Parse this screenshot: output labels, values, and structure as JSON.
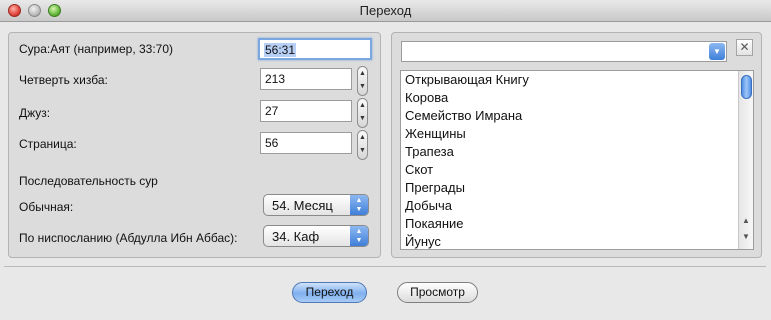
{
  "window": {
    "title": "Переход"
  },
  "left": {
    "sura_ayat_label": "Сура:Аят (например, 33:70)",
    "sura_ayat_value": "56:31",
    "hizb_label": "Четверть хизба:",
    "hizb_value": "213",
    "juz_label": "Джуз:",
    "juz_value": "27",
    "page_label": "Страница:",
    "page_value": "56",
    "order_heading": "Последовательность сур",
    "ordinary_label": "Обычная:",
    "ordinary_value": "54. Месяц",
    "revelation_label": "По ниспосланию (Абдулла Ибн Аббас):",
    "revelation_value": "34. Каф"
  },
  "right": {
    "search_value": "",
    "suras": [
      "Открывающая Книгу",
      "Корова",
      "Семейство Имрана",
      "Женщины",
      "Трапеза",
      "Скот",
      "Преграды",
      "Добыча",
      "Покаяние",
      "Йунус"
    ]
  },
  "buttons": {
    "go": "Переход",
    "view": "Просмотр"
  },
  "colors": {
    "accent": "#4f8fe6",
    "focus_ring": "#7aa7e0"
  },
  "icons": {
    "clear": "close-icon",
    "stepper": "up-down-arrows-icon",
    "dropdown": "chevron-down-icon"
  }
}
